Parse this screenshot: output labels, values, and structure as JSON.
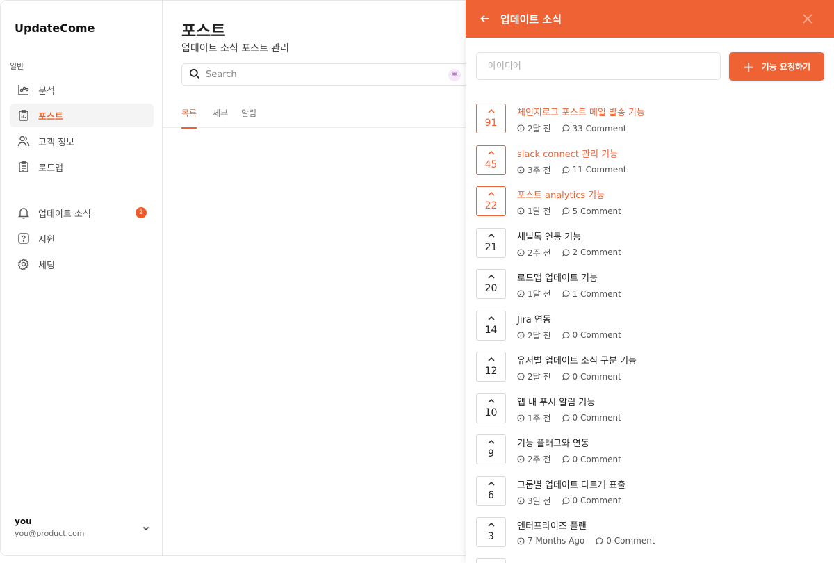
{
  "app": {
    "brand": "UpdateCome"
  },
  "sidebar": {
    "section_label": "일반",
    "items": [
      {
        "label": "분석",
        "icon": "analytics-icon"
      },
      {
        "label": "포스트",
        "icon": "post-icon",
        "active": true
      },
      {
        "label": "고객 정보",
        "icon": "users-icon"
      },
      {
        "label": "로드맵",
        "icon": "clipboard-icon"
      }
    ],
    "items2": [
      {
        "label": "업데이트 소식",
        "icon": "bell-icon",
        "badge": "2"
      },
      {
        "label": "지원",
        "icon": "help-icon"
      },
      {
        "label": "세팅",
        "icon": "gear-icon"
      }
    ],
    "user": {
      "name": "you",
      "email": "you@product.com"
    }
  },
  "main": {
    "title": "포스트",
    "subtitle": "업데이트 소식 포스트 관리",
    "search_placeholder": "Search",
    "shortcut": "⌘",
    "tabs": [
      {
        "label": "목록",
        "active": true
      },
      {
        "label": "세부"
      },
      {
        "label": "알림"
      }
    ]
  },
  "panel": {
    "title": "업데이트 소식",
    "input_placeholder": "아이디어",
    "request_button": "기능 요청하기",
    "features": [
      {
        "votes": "91",
        "title": "체인지로그 포스트 메일 발송 기능",
        "time": "2달 전",
        "comments": "33 Comment",
        "highlight": true
      },
      {
        "votes": "45",
        "title": " slack connect 관리 기능",
        "time": "3주 전",
        "comments": "11 Comment",
        "highlight": true
      },
      {
        "votes": "22",
        "title": "포스트 analytics 기능",
        "time": "1달 전",
        "comments": "5 Comment",
        "highlight": true
      },
      {
        "votes": "21",
        "title": "채널톡 연동 기능",
        "time": "2주 전",
        "comments": "2 Comment",
        "highlight": false
      },
      {
        "votes": "20",
        "title": "로드맵 업데이트 기능",
        "time": "1달 전",
        "comments": "1 Comment",
        "highlight": false
      },
      {
        "votes": "14",
        "title": "Jira 연동",
        "time": "2달 전",
        "comments": "0 Comment",
        "highlight": false
      },
      {
        "votes": "12",
        "title": "유저별 업데이트 소식 구분 기능",
        "time": "2달 전",
        "comments": "0 Comment",
        "highlight": false
      },
      {
        "votes": "10",
        "title": "앱 내 푸시 알림 기능",
        "time": "1주 전",
        "comments": "0 Comment",
        "highlight": false
      },
      {
        "votes": "9",
        "title": "기능 플래그와 연동",
        "time": "2주 전",
        "comments": "0 Comment",
        "highlight": false
      },
      {
        "votes": "6",
        "title": "그룹별 업데이트 다르게 표출",
        "time": "3일 전",
        "comments": "0 Comment",
        "highlight": false
      },
      {
        "votes": "3",
        "title": "엔터프라이즈 플랜",
        "time": "7 Months Ago",
        "comments": "0 Comment",
        "highlight": false
      }
    ]
  },
  "colors": {
    "accent": "#ef6234",
    "accent_text": "#e8622f"
  }
}
